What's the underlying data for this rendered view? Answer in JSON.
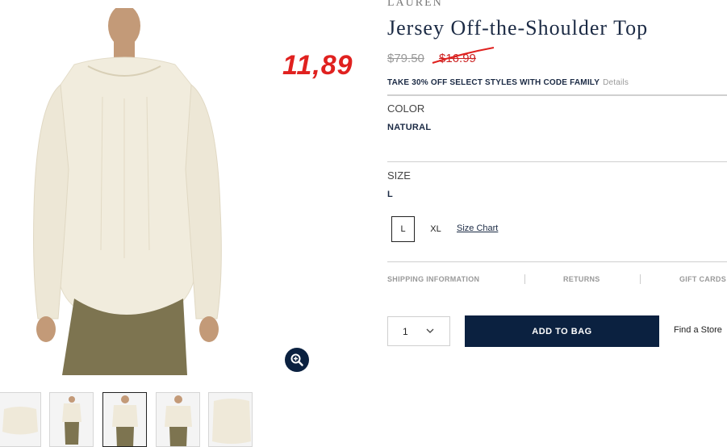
{
  "annotation": {
    "price": "11,89"
  },
  "product": {
    "brand": "LAUREN",
    "title": "Jersey Off-the-Shoulder Top",
    "original_price": "$79.50",
    "sale_price": "$16.99",
    "promo": "TAKE 30% OFF SELECT STYLES WITH CODE FAMILY",
    "promo_details": "Details"
  },
  "color": {
    "label": "COLOR",
    "value": "NATURAL"
  },
  "size": {
    "label": "SIZE",
    "value": "L",
    "options": [
      "L",
      "XL"
    ],
    "size_chart": "Size Chart"
  },
  "info_links": [
    "SHIPPING INFORMATION",
    "RETURNS",
    "GIFT CARDS"
  ],
  "purchase": {
    "quantity": "1",
    "add_to_bag": "ADD TO BAG",
    "find_store": "Find a Store"
  },
  "colors": {
    "navy": "#0b2140",
    "annotation_red": "#e0211f",
    "garment": "#f0ebdc",
    "pants": "#7d7450"
  },
  "icons": {
    "zoom": "zoom-in-icon",
    "quantity_chevron": "chevron-down-icon"
  }
}
